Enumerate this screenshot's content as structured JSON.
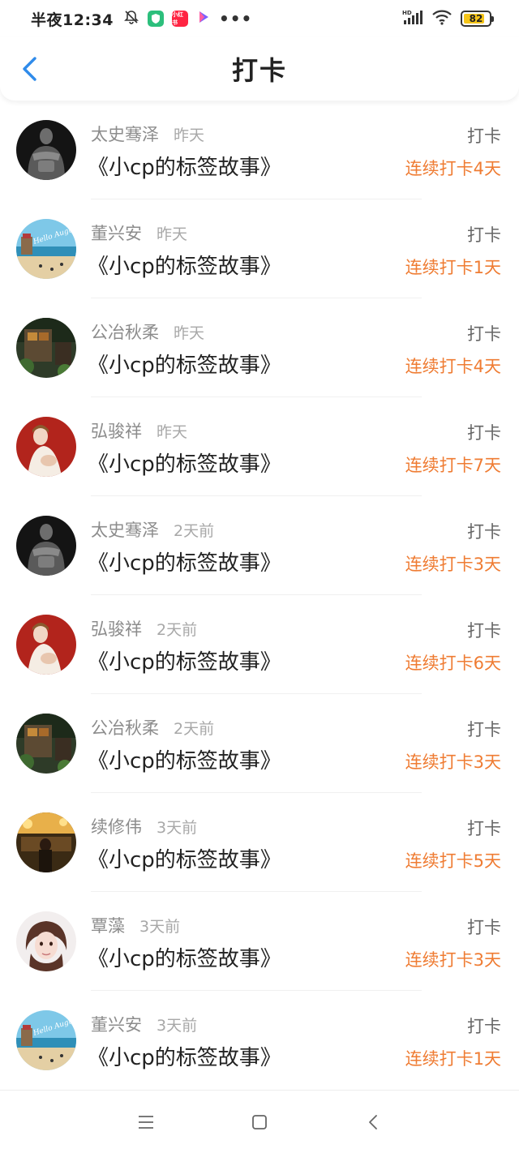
{
  "status_bar": {
    "time": "半夜12:34",
    "app_badge": "小红书",
    "dots": "•••",
    "battery": "82",
    "battery_level": 0.82,
    "net_label": "HD"
  },
  "header": {
    "title": "打卡"
  },
  "colors": {
    "accent_blue": "#2f8bea",
    "streak_orange": "#ef7c33"
  },
  "entries": [
    {
      "user": "太史骞泽",
      "time": "昨天",
      "book": "《小cp的标签故事》",
      "action": "打卡",
      "streak": "连续打卡4天"
    },
    {
      "user": "董兴安",
      "time": "昨天",
      "book": "《小cp的标签故事》",
      "action": "打卡",
      "streak": "连续打卡1天"
    },
    {
      "user": "公冶秋柔",
      "time": "昨天",
      "book": "《小cp的标签故事》",
      "action": "打卡",
      "streak": "连续打卡4天"
    },
    {
      "user": "弘骏祥",
      "time": "昨天",
      "book": "《小cp的标签故事》",
      "action": "打卡",
      "streak": "连续打卡7天"
    },
    {
      "user": "太史骞泽",
      "time": "2天前",
      "book": "《小cp的标签故事》",
      "action": "打卡",
      "streak": "连续打卡3天"
    },
    {
      "user": "弘骏祥",
      "time": "2天前",
      "book": "《小cp的标签故事》",
      "action": "打卡",
      "streak": "连续打卡6天"
    },
    {
      "user": "公冶秋柔",
      "time": "2天前",
      "book": "《小cp的标签故事》",
      "action": "打卡",
      "streak": "连续打卡3天"
    },
    {
      "user": "续修伟",
      "time": "3天前",
      "book": "《小cp的标签故事》",
      "action": "打卡",
      "streak": "连续打卡5天"
    },
    {
      "user": "覃藻",
      "time": "3天前",
      "book": "《小cp的标签故事》",
      "action": "打卡",
      "streak": "连续打卡3天"
    },
    {
      "user": "董兴安",
      "time": "3天前",
      "book": "《小cp的标签故事》",
      "action": "打卡",
      "streak": "连续打卡1天"
    }
  ],
  "avatar_text": {
    "beach": "Hello August"
  },
  "nav": {
    "menu_icon": "menu-icon",
    "home_icon": "home-square-icon",
    "back_icon": "back-triangle-icon"
  }
}
